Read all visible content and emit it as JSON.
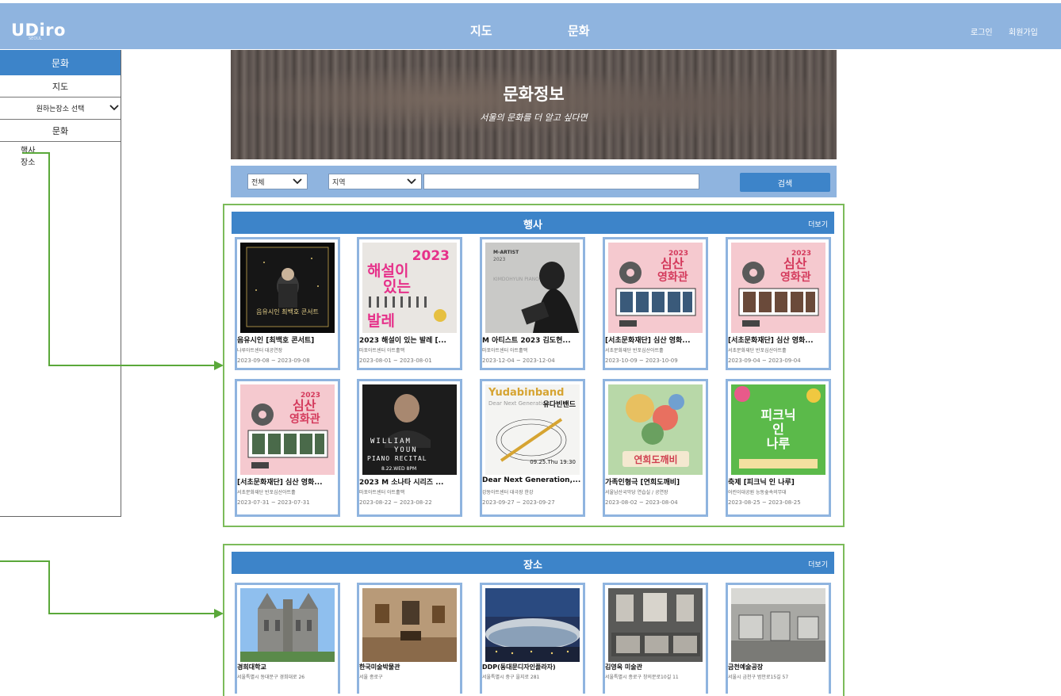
{
  "header": {
    "logo": "UDiro",
    "logo_sub": "SEOUL",
    "nav": [
      "지도",
      "문화"
    ],
    "login": "로그인",
    "signup": "회원가입"
  },
  "sidebar": {
    "active": "문화",
    "map": "지도",
    "place_select": "원하는장소 선택",
    "culture": "문화",
    "sub_items": [
      "행사",
      "장소"
    ]
  },
  "banner": {
    "title": "문화정보",
    "subtitle": "서울의 문화를 더 알고 싶다면"
  },
  "search": {
    "category": "전체",
    "region": "지역",
    "button": "검색"
  },
  "events": {
    "title": "행사",
    "more": "더보기",
    "items": [
      {
        "title": "음유시인 [최백호 콘서트]",
        "venue": "나루아트센터 대공연장",
        "date": "2023-09-08 ~ 2023-09-08"
      },
      {
        "title": "2023 해설이 있는 발레 [...",
        "venue": "마포아트센터 아트홀맥",
        "date": "2023-08-01 ~ 2023-08-01"
      },
      {
        "title": "M 아티스트 2023 김도현...",
        "venue": "마포아트센터 아트홀맥",
        "date": "2023-12-04 ~ 2023-12-04"
      },
      {
        "title": "[서초문화재단] 심산 영화...",
        "venue": "서초문화재단 반포심산아트홀",
        "date": "2023-10-09 ~ 2023-10-09"
      },
      {
        "title": "[서초문화재단] 심산 영화...",
        "venue": "서초문화재단 반포심산아트홀",
        "date": "2023-09-04 ~ 2023-09-04"
      },
      {
        "title": "[서초문화재단] 심산 영화...",
        "venue": "서초문화재단 반포심산아트홀",
        "date": "2023-07-31 ~ 2023-07-31"
      },
      {
        "title": "2023 M 소나타 시리즈 ...",
        "venue": "마포아트센터 아트홀맥",
        "date": "2023-08-22 ~ 2023-08-22"
      },
      {
        "title": "Dear Next Generation,...",
        "venue": "강동아트센터 대극장 한강",
        "date": "2023-09-27 ~ 2023-09-27"
      },
      {
        "title": "가족인형극 [연희도깨비]",
        "venue": "서울남산국악당 연습실 / 공연장",
        "date": "2023-08-02 ~ 2023-08-04"
      },
      {
        "title": "축제 [피크닉 인 나루]",
        "venue": "어린이대공원 능동숲속의무대",
        "date": "2023-08-25 ~ 2023-08-25"
      }
    ],
    "poster_texts": {
      "p1": "음유시인 최백호 콘서트",
      "p2_year": "2023",
      "p2_a": "해설이",
      "p2_b": "있는",
      "p2_c": "발레",
      "p3_a": "M-ARTIST",
      "p3_b": "2023",
      "p3_c": "KIMDOHYUN PIANO RECITAL",
      "p4_a": "2023",
      "p4_b": "심산",
      "p4_c": "영화관",
      "p7_a": "WILLIAM",
      "p7_b": "YOUN",
      "p7_c": "PIANO RECITAL",
      "p7_d": "8.22.WED 8PM",
      "p8_a": "Yudabinband",
      "p8_b": "Dear Next Generation",
      "p8_c": "유다빈밴드",
      "p8_d": "09.25.Thu 19:30",
      "p9": "연희도깨비",
      "p10_a": "피크닉",
      "p10_b": "인",
      "p10_c": "나루"
    }
  },
  "places": {
    "title": "장소",
    "more": "더보기",
    "items": [
      {
        "title": "경희대학교",
        "addr": "서울특별시 동대문구 경희대로 26"
      },
      {
        "title": "한국미술박물관",
        "addr": "서울 종로구"
      },
      {
        "title": "DDP(동대문디자인플라자)",
        "addr": "서울특별시 중구 을지로 281"
      },
      {
        "title": "김영옥 미술관",
        "addr": "서울특별시 종로구 창의문로10길 11"
      },
      {
        "title": "금천예술공장",
        "addr": "서울시 금천구 범안로15길 57"
      }
    ]
  },
  "colors": {
    "header": "#8fb4df",
    "accent": "#3d84c9",
    "frame": "#7cbb5a",
    "card_border": "#8fb4df"
  }
}
